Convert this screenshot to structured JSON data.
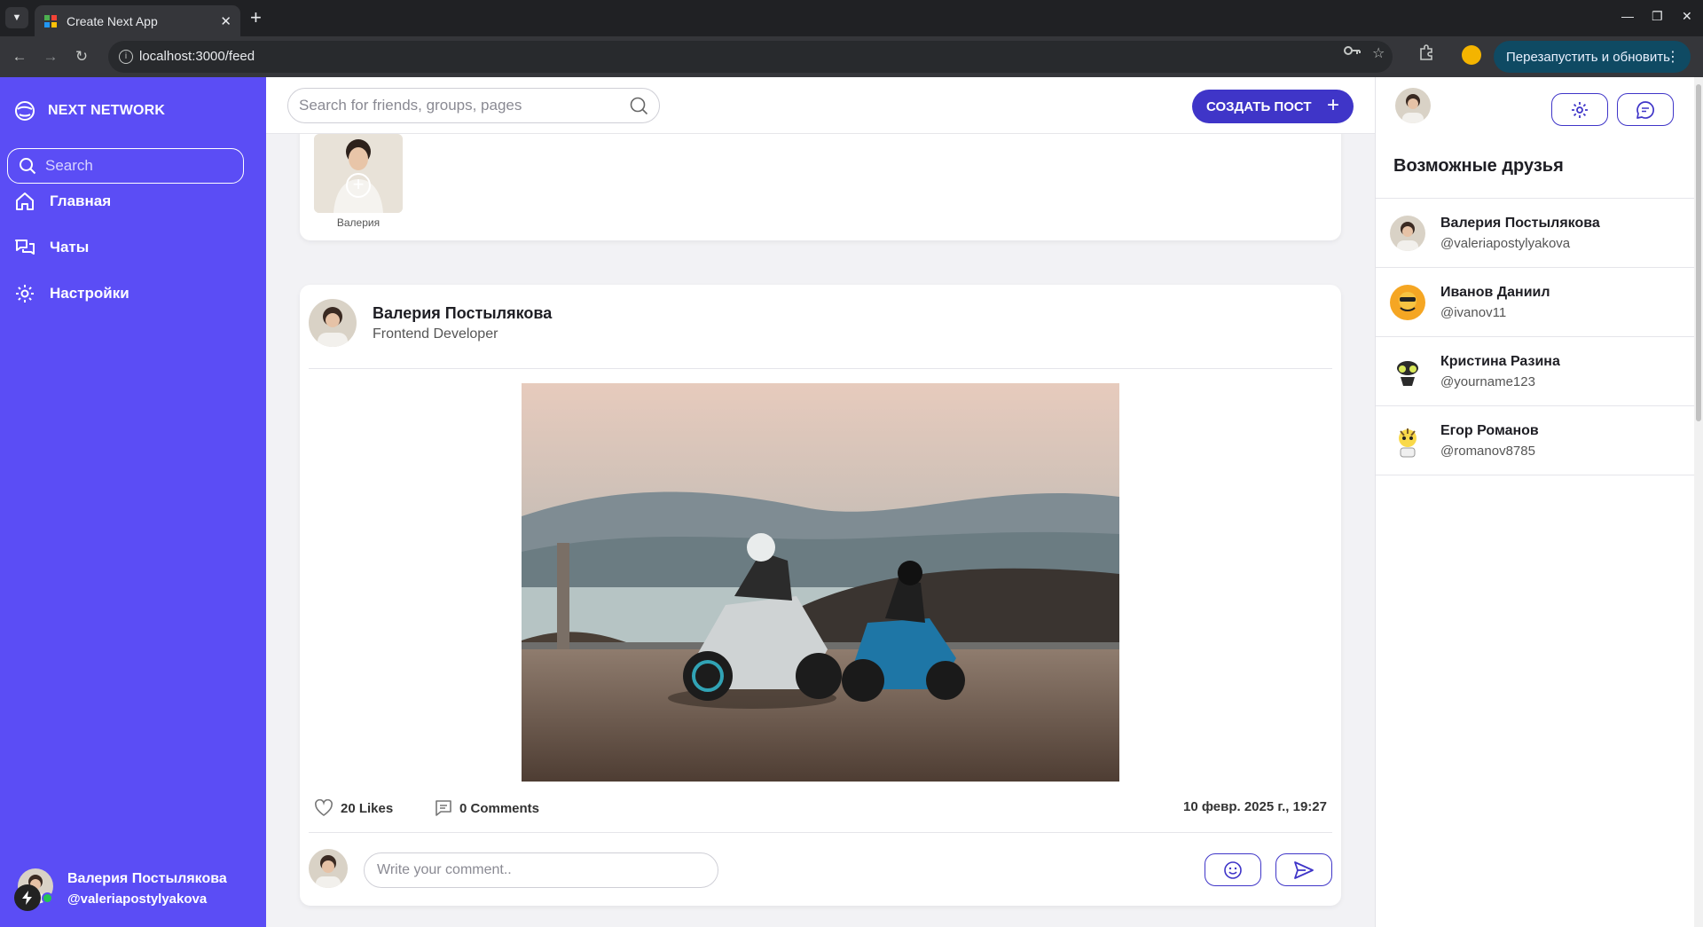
{
  "browser": {
    "tab_title": "Create Next App",
    "url": "localhost:3000/feed",
    "update_button": "Перезапустить и обновить"
  },
  "sidebar": {
    "brand": "NEXT NETWORK",
    "search_placeholder": "Search",
    "nav": [
      {
        "label": "Главная",
        "icon": "home-icon"
      },
      {
        "label": "Чаты",
        "icon": "chats-icon"
      },
      {
        "label": "Настройки",
        "icon": "settings-icon"
      }
    ],
    "user": {
      "name": "Валерия Постылякова",
      "handle": "@valeriapostylyakova"
    }
  },
  "header": {
    "search_placeholder": "Search for friends, groups, pages",
    "create_post": "СОЗДАТЬ ПОСТ"
  },
  "stories": [
    {
      "name": "Валерия"
    }
  ],
  "post": {
    "author": "Валерия Постылякова",
    "role": "Frontend Developer",
    "likes": "20 Likes",
    "comments": "0 Comments",
    "date": "10 февр. 2025 г., 19:27",
    "comment_placeholder": "Write your comment.."
  },
  "right_panel": {
    "title": "Возможные друзья",
    "friends": [
      {
        "name": "Валерия Постылякова",
        "handle": "@valeriapostylyakova"
      },
      {
        "name": "Иванов Даниил",
        "handle": "@ivanov11"
      },
      {
        "name": "Кристина Разина",
        "handle": "@yourname123"
      },
      {
        "name": "Егор Романов",
        "handle": "@romanov8785"
      }
    ]
  },
  "colors": {
    "sidebar": "#5b4df5",
    "accent": "#3f35c8",
    "online": "#23c552"
  }
}
